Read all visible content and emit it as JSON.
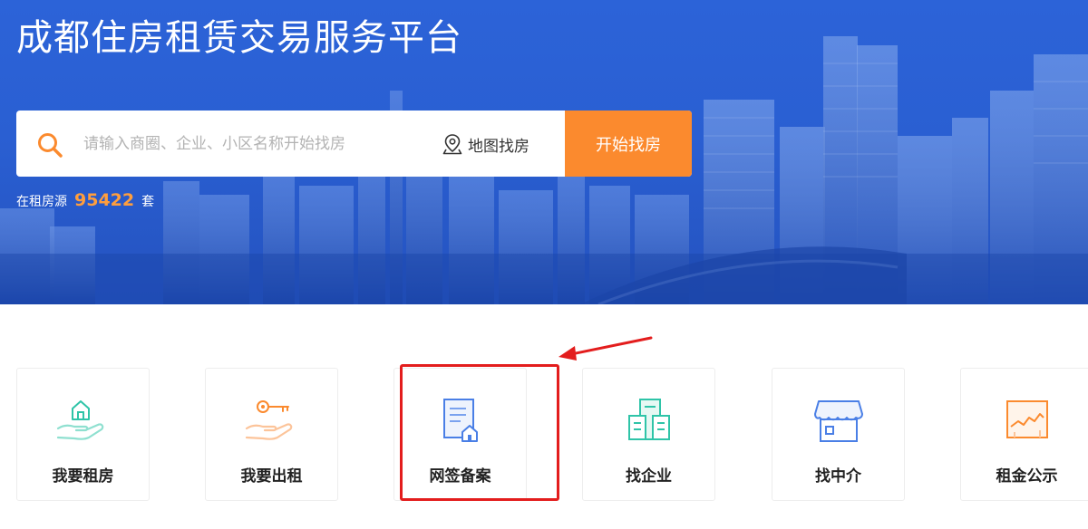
{
  "hero": {
    "title": "成都住房租赁交易服务平台",
    "search": {
      "placeholder": "请输入商圈、企业、小区名称开始找房",
      "icon": "search-icon",
      "map_label": "地图找房",
      "map_icon": "location-pin-icon",
      "button_label": "开始找房",
      "button_color": "#fb8a2e"
    },
    "stats": {
      "prefix": "在租房源",
      "count": "95422",
      "suffix": "套"
    }
  },
  "services": [
    {
      "label": "我要租房",
      "icon": "house-hand-icon"
    },
    {
      "label": "我要出租",
      "icon": "key-hand-icon"
    },
    {
      "label": "网签备案",
      "icon": "contract-document-icon"
    },
    {
      "label": "找企业",
      "icon": "office-buildings-icon"
    },
    {
      "label": "找中介",
      "icon": "storefront-icon"
    },
    {
      "label": "租金公示",
      "icon": "rent-chart-icon"
    }
  ],
  "annotation": {
    "highlighted_item": "网签备案",
    "color": "#e31d1d"
  }
}
